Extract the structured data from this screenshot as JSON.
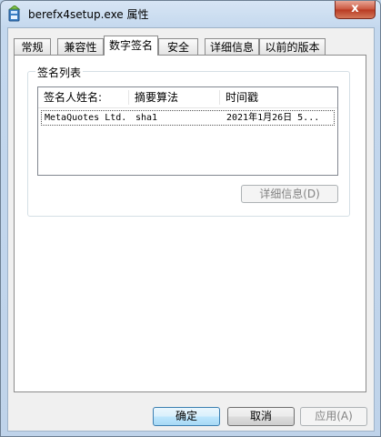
{
  "window": {
    "title": "berefx4setup.exe 属性",
    "close_glyph": "x",
    "icon": "setup-app-icon"
  },
  "tabs": [
    {
      "label": "常规",
      "active": false
    },
    {
      "label": "兼容性",
      "active": false
    },
    {
      "label": "数字签名",
      "active": true
    },
    {
      "label": "安全",
      "active": false
    },
    {
      "label": "详细信息",
      "active": false
    },
    {
      "label": "以前的版本",
      "active": false
    }
  ],
  "signature_group": {
    "label": "签名列表",
    "columns": [
      "签名人姓名:",
      "摘要算法",
      "时间戳"
    ],
    "rows": [
      {
        "signer": "MetaQuotes Ltd.",
        "digest": "sha1",
        "timestamp": "2021年1月26日 5..."
      }
    ],
    "details_button": "详细信息(D)"
  },
  "buttons": {
    "ok": "确定",
    "cancel": "取消",
    "apply": "应用(A)"
  }
}
